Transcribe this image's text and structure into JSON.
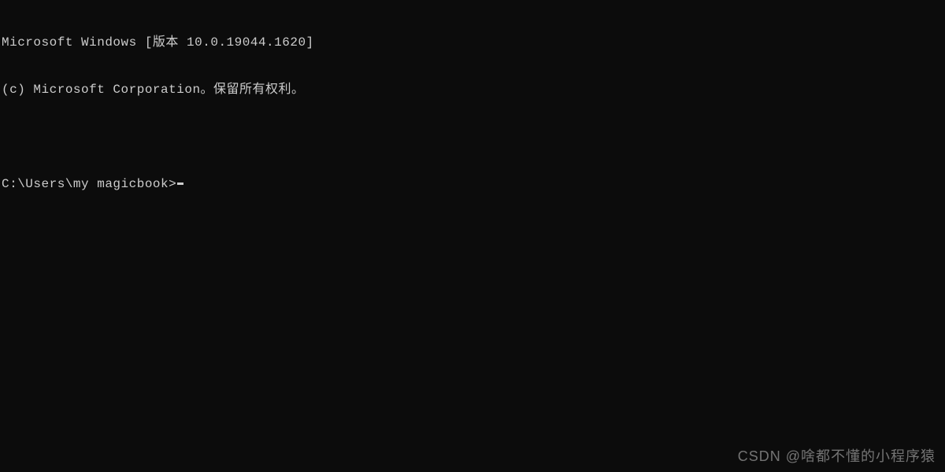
{
  "terminal": {
    "version_line": "Microsoft Windows [版本 10.0.19044.1620]",
    "copyright_line": "(c) Microsoft Corporation。保留所有权利。",
    "blank": "",
    "prompt": "C:\\Users\\my magicbook>"
  },
  "watermark": {
    "text": "CSDN @啥都不懂的小程序猿"
  }
}
